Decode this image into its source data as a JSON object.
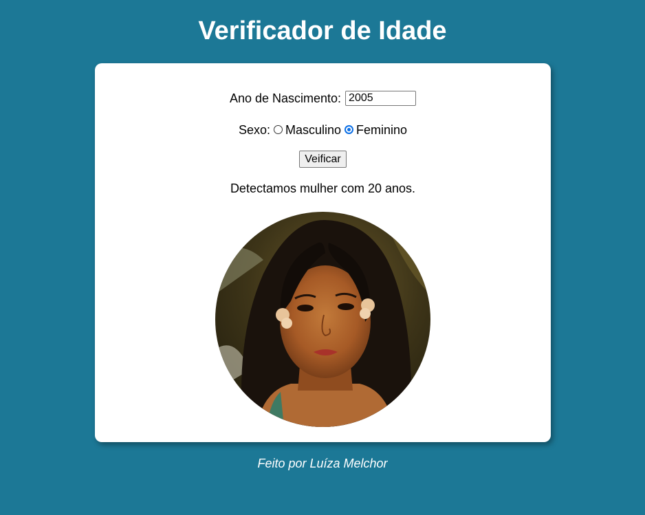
{
  "page": {
    "title": "Verificador de Idade",
    "footer": "Feito por Luíza Melchor"
  },
  "form": {
    "year_label": "Ano de Nascimento:",
    "year_value": "2005",
    "sex_label": "Sexo:",
    "options": [
      {
        "label": "Masculino",
        "checked": false
      },
      {
        "label": "Feminino",
        "checked": true
      }
    ],
    "button_label": "Veificar"
  },
  "result": {
    "text": "Detectamos mulher com 20 anos.",
    "image": "woman-portrait"
  },
  "colors": {
    "background": "#1c7896",
    "card": "#ffffff",
    "radio_accent": "#0b6fe6"
  }
}
